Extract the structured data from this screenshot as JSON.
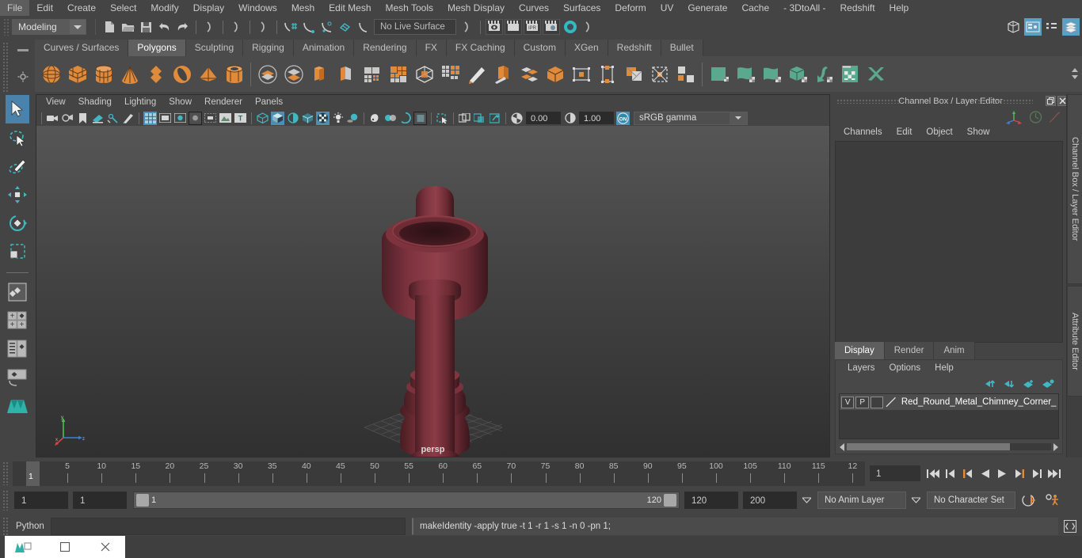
{
  "app": {
    "title": "Autodesk Maya"
  },
  "menubar": {
    "items": [
      "File",
      "Edit",
      "Create",
      "Select",
      "Modify",
      "Display",
      "Windows",
      "Mesh",
      "Edit Mesh",
      "Mesh Tools",
      "Mesh Display",
      "Curves",
      "Surfaces",
      "Deform",
      "UV",
      "Generate",
      "Cache",
      "- 3DtoAll -",
      "Redshift",
      "Help"
    ]
  },
  "statusline": {
    "menuset": "Modeling",
    "live_surface": "No Live Surface",
    "render_buttons": [
      "render-icon",
      "render-region-icon",
      "ipr-icon",
      "render-settings-icon"
    ],
    "right_icons": [
      "modeling-toolkit-icon",
      "attribute-editor-icon",
      "tool-settings-icon",
      "channel-box-icon"
    ]
  },
  "shelf": {
    "tabs": [
      "Curves / Surfaces",
      "Polygons",
      "Sculpting",
      "Rigging",
      "Animation",
      "Rendering",
      "FX",
      "FX Caching",
      "Custom",
      "XGen",
      "Redshift",
      "Bullet"
    ],
    "active_tab": "Polygons",
    "icon_names": [
      "poly-sphere",
      "poly-cube",
      "poly-cylinder",
      "poly-cone",
      "poly-platonic",
      "poly-torus",
      "poly-pyramid",
      "poly-pipe",
      "combine",
      "separate",
      "extrude",
      "bevel",
      "smooth",
      "mirror",
      "sculpt-tool",
      "multi-cut",
      "boolean",
      "connect",
      "bridge",
      "target-weld",
      "crease",
      "quad-draw",
      "mesh-display",
      "uv-planar",
      "uv-cylindrical",
      "uv-spherical",
      "uv-automatic",
      "uv-unfold",
      "uv-editor",
      "uv-layout"
    ]
  },
  "toolbox": {
    "items": [
      "select-tool",
      "lasso-select-tool",
      "paint-select-tool",
      "move-tool",
      "rotate-tool",
      "scale-tool",
      "last-tool",
      "pane-layout-single",
      "pane-layout-quad",
      "pane-layout-outliner",
      "pane-layout-hypergraph",
      "maya-logo"
    ]
  },
  "viewport": {
    "menus": [
      "View",
      "Shading",
      "Lighting",
      "Show",
      "Renderer",
      "Panels"
    ],
    "exposure": "0.00",
    "gamma": "1.00",
    "color_profile": "sRGB gamma",
    "camera_label": "persp",
    "toolbar_icons": [
      "select-camera-icon",
      "camera-attributes-icon",
      "bookmark-icon",
      "image-plane-icon",
      "two-d-pan-zoom-icon",
      "grease-pencil-icon",
      "grid-icon",
      "film-gate-icon",
      "resolution-gate-icon",
      "gate-mask-icon",
      "film-origin-icon",
      "exposure-icon",
      "xray-icon",
      "wireframe-icon",
      "smooth-shade-icon",
      "shaded-wireframe-icon",
      "textured-icon",
      "use-all-lights-icon",
      "shadows-icon",
      "ambient-occlusion-icon",
      "motion-blur-icon",
      "multisample-icon",
      "depth-of-field-icon",
      "isolate-select-icon",
      "viewport-snapshot-icon"
    ]
  },
  "dock": {
    "title": "Channel Box / Layer Editor",
    "menus": [
      "Channels",
      "Edit",
      "Object",
      "Show"
    ],
    "window_buttons": [
      "restore-icon",
      "close-icon"
    ],
    "vertical_tabs": [
      "Channel Box / Layer Editor",
      "Attribute Editor"
    ]
  },
  "layer_editor": {
    "tabs": [
      "Display",
      "Render",
      "Anim"
    ],
    "active_tab": "Display",
    "menus": [
      "Layers",
      "Options",
      "Help"
    ],
    "tool_icons": [
      "move-layer-up-icon",
      "move-layer-down-icon",
      "new-layer-icon",
      "new-layer-from-selected-icon"
    ],
    "layers": [
      {
        "visibility": "V",
        "playback": "P",
        "state": "",
        "name": "Red_Round_Metal_Chimney_Corner_B"
      }
    ]
  },
  "timeline": {
    "ticks": [
      5,
      10,
      15,
      20,
      25,
      30,
      35,
      40,
      45,
      50,
      55,
      60,
      65,
      70,
      75,
      80,
      85,
      90,
      95,
      100,
      105,
      110,
      115,
      12
    ],
    "current_frame_marker": "1",
    "current_frame_field": "1",
    "playback_buttons": [
      "go-to-start-icon",
      "step-back-keyframe-icon",
      "step-back-frame-icon",
      "play-backwards-icon",
      "play-forwards-icon",
      "step-forward-frame-icon",
      "step-forward-keyframe-icon",
      "go-to-end-icon"
    ]
  },
  "range": {
    "anim_start": "1",
    "range_start": "1",
    "slider_start_label": "1",
    "slider_end_label": "120",
    "range_end": "120",
    "anim_end": "200",
    "anim_layer": "No Anim Layer",
    "character_set": "No Character Set",
    "right_icons": [
      "auto-keyframe-icon",
      "animation-preferences-icon"
    ]
  },
  "command_line": {
    "language": "Python",
    "input_value": "",
    "output": "makeIdentity -apply true -t 1 -r 1 -s 1 -n 0 -pn 1;",
    "script_editor_icon": "script-editor-icon"
  },
  "taskbar": {
    "items": [
      "maya-app-icon",
      "maximize-icon",
      "close-icon"
    ]
  },
  "colors": {
    "accent_teal": "#3fb8c4",
    "accent_orange": "#e08a3c",
    "selection_blue": "#4a82ab",
    "panel_bg": "#444444",
    "model_red": "#7a2b33"
  }
}
